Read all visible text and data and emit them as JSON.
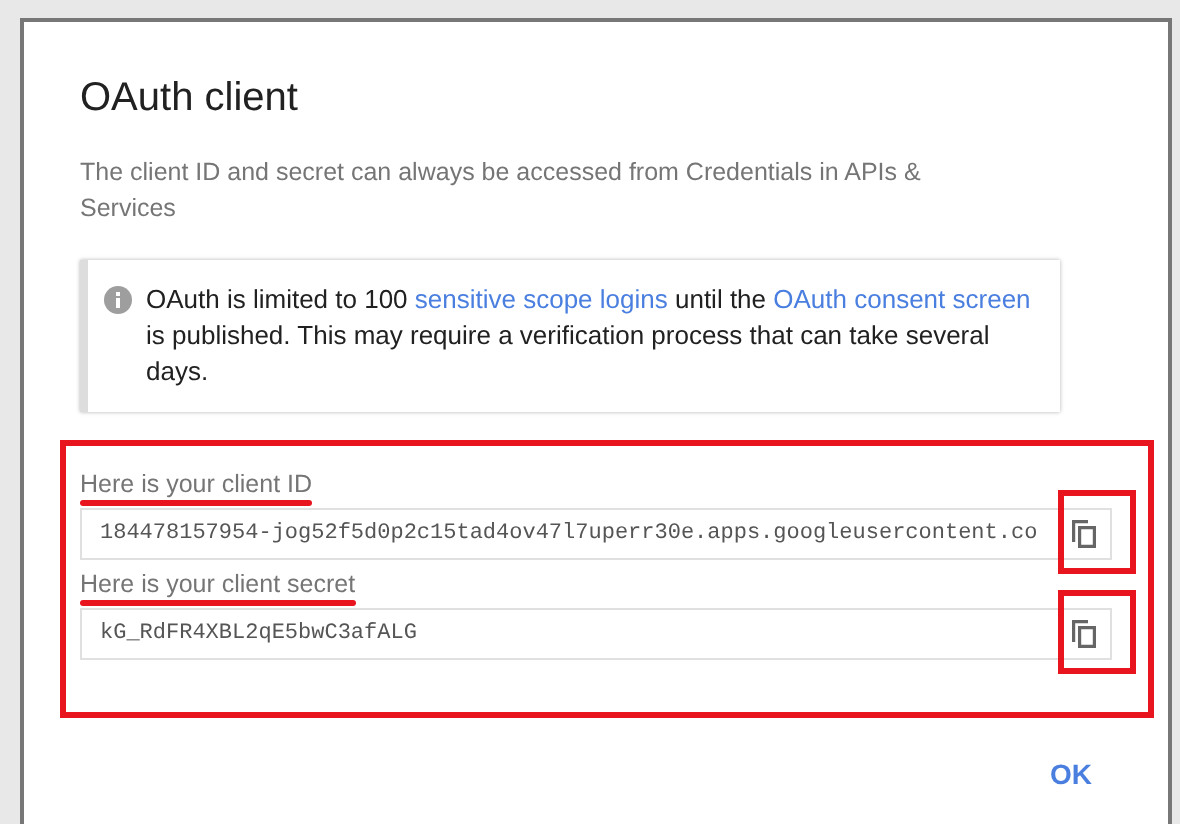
{
  "dialog": {
    "title": "OAuth client",
    "description": "The client ID and secret can always be accessed from Credentials in APIs & Services",
    "notice": {
      "parts": [
        {
          "kind": "text",
          "text": "OAuth is limited to 100 "
        },
        {
          "kind": "link",
          "text": "sensitive scope logins"
        },
        {
          "kind": "text",
          "text": " until the "
        },
        {
          "kind": "link",
          "text": "OAuth consent "
        },
        {
          "kind": "link",
          "text": "screen"
        },
        {
          "kind": "text",
          "text": " is published. This may require a verification process that can take several days."
        }
      ]
    },
    "fields": [
      {
        "label": "Here is your client ID",
        "value": "184478157954-jog52f5d0p2c15tad4ov47l7uperr30e.apps.googleusercontent.co"
      },
      {
        "label": "Here is your client secret",
        "value": "kG_RdFR4XBL2qE5bwC3afALG"
      }
    ],
    "button": "OK"
  }
}
